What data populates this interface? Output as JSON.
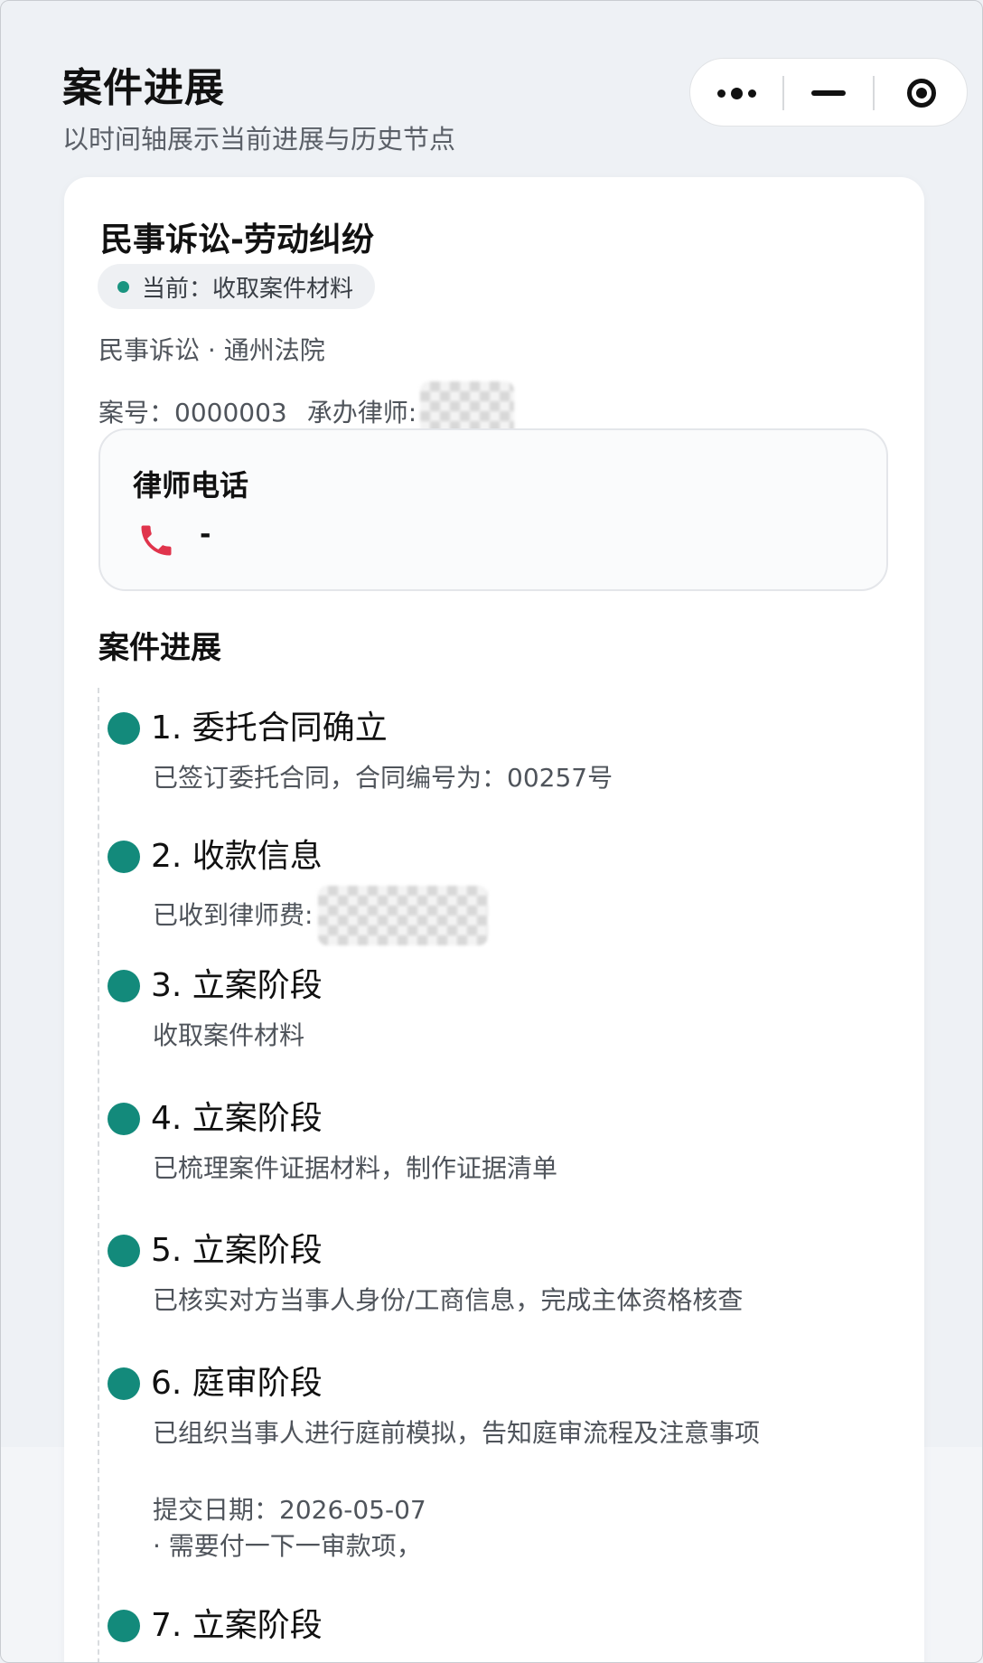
{
  "header": {
    "title": "案件进展",
    "subtitle": "以时间轴展示当前进展与历史节点"
  },
  "capsule": {
    "more_icon": "more-dots-icon",
    "minimize_icon": "minus-icon",
    "close_icon": "target-circle-icon"
  },
  "case": {
    "title": "民事诉讼-劳动纠纷",
    "status": "当前：收取案件材料",
    "type_court": "民事诉讼 · 通州法院",
    "case_no": "案号：0000003",
    "lawyer_label": "承办律师:"
  },
  "phone": {
    "label": "律师电话",
    "icon": "phone-icon",
    "value": "-"
  },
  "timeline": {
    "title": "案件进展",
    "items": [
      {
        "title": "1. 委托合同确立",
        "desc": "已签订委托合同，合同编号为：00257号"
      },
      {
        "title": "2. 收款信息",
        "desc": "已收到律师费:"
      },
      {
        "title": "3. 立案阶段",
        "desc": "收取案件材料"
      },
      {
        "title": "4. 立案阶段",
        "desc": "已梳理案件证据材料，制作证据清单"
      },
      {
        "title": "5. 立案阶段",
        "desc": "已核实对方当事人身份/工商信息，完成主体资格核查"
      },
      {
        "title": "6. 庭审阶段",
        "desc": "已组织当事人进行庭前模拟，告知庭审流程及注意事项",
        "date": "提交日期：2026-05-07",
        "note": "· 需要付一下一审款项，"
      },
      {
        "title": "7. 立案阶段",
        "desc": ""
      }
    ]
  },
  "colors": {
    "accent": "#138a7b",
    "status_dot": "#1a9480",
    "phone_icon": "#e0344c"
  }
}
